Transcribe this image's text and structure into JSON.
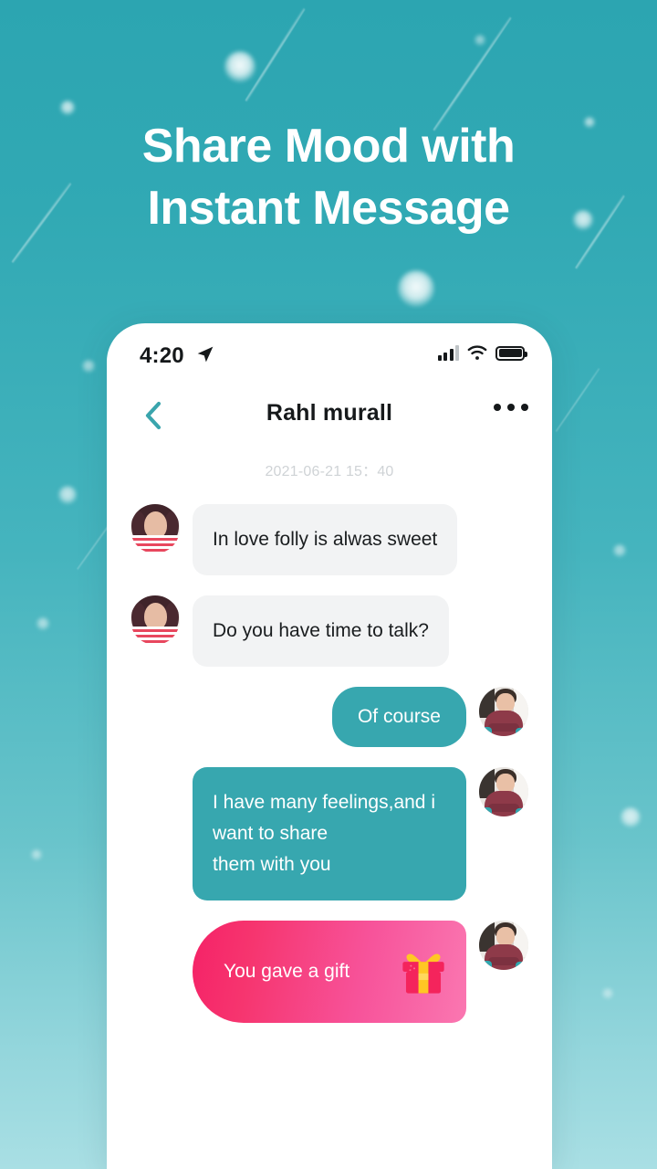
{
  "headline": {
    "line1": "Share Mood with",
    "line2": "Instant Message"
  },
  "colors": {
    "background_top": "#2CA5B1",
    "background_bottom": "#A9DFE4",
    "accent_teal": "#37A7AF",
    "bubble_grey": "#F2F3F4",
    "gift_pink_start": "#F52267",
    "gift_pink_end": "#FA77B1",
    "text_dark": "#16191B",
    "timestamp_grey": "#CFD3D6"
  },
  "phone": {
    "status_bar": {
      "time": "4:20",
      "location_icon": "location-arrow-icon",
      "signal_icon": "signal-bars-icon",
      "wifi_icon": "wifi-icon",
      "battery_icon": "battery-icon"
    },
    "nav": {
      "back_icon": "chevron-left-icon",
      "title": "Rahl murall",
      "more_icon": "more-horizontal-icon"
    },
    "chat": {
      "timestamp": "2021-06-21 15：40",
      "messages": [
        {
          "side": "them",
          "type": "text",
          "text": "In love folly is alwas sweet",
          "avatar": "woman-avatar"
        },
        {
          "side": "them",
          "type": "text",
          "text": "Do you have time to talk?",
          "avatar": "woman-avatar"
        },
        {
          "side": "me",
          "type": "pill",
          "text": "Of course",
          "avatar": "man-avatar"
        },
        {
          "side": "me",
          "type": "text",
          "text": "I have many feelings,and i want to share\nthem with you",
          "avatar": "man-avatar"
        },
        {
          "side": "me",
          "type": "gift",
          "text": "You gave a gift",
          "icon": "gift-icon",
          "avatar": "man-avatar"
        }
      ]
    }
  }
}
